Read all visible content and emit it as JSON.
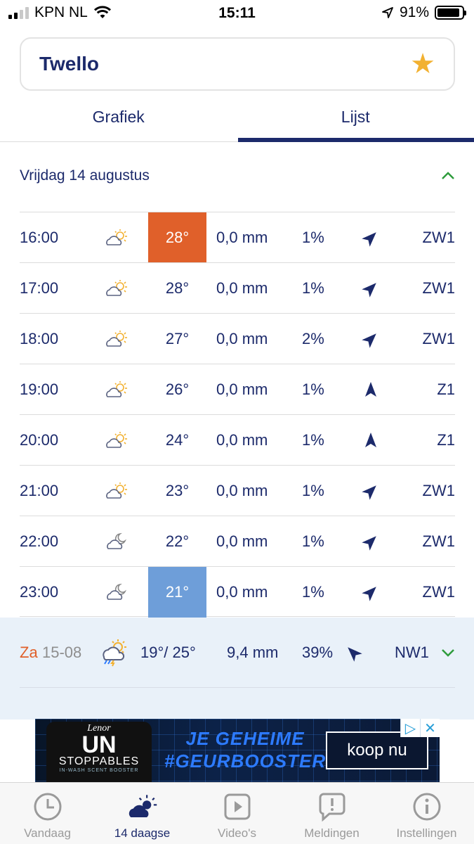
{
  "status_bar": {
    "carrier": "KPN NL",
    "time": "15:11",
    "battery": "91%"
  },
  "location": {
    "name": "Twello",
    "favorite_icon": "star-icon"
  },
  "tabs": [
    {
      "label": "Grafiek",
      "active": false
    },
    {
      "label": "Lijst",
      "active": true
    }
  ],
  "day": {
    "title": "Vrijdag 14 augustus"
  },
  "hours": [
    {
      "time": "16:00",
      "icon": "partly-cloudy-sun-icon",
      "temp": "28°",
      "highlight": "hot",
      "precip": "0,0 mm",
      "chance": "1%",
      "wind_dir": "ZW",
      "wind": "ZW1"
    },
    {
      "time": "17:00",
      "icon": "partly-cloudy-sun-icon",
      "temp": "28°",
      "highlight": "",
      "precip": "0,0 mm",
      "chance": "1%",
      "wind_dir": "ZW",
      "wind": "ZW1"
    },
    {
      "time": "18:00",
      "icon": "partly-cloudy-sun-icon",
      "temp": "27°",
      "highlight": "",
      "precip": "0,0 mm",
      "chance": "2%",
      "wind_dir": "ZW",
      "wind": "ZW1"
    },
    {
      "time": "19:00",
      "icon": "partly-cloudy-sun-icon",
      "temp": "26°",
      "highlight": "",
      "precip": "0,0 mm",
      "chance": "1%",
      "wind_dir": "Z",
      "wind": "Z1"
    },
    {
      "time": "20:00",
      "icon": "partly-cloudy-sun-icon",
      "temp": "24°",
      "highlight": "",
      "precip": "0,0 mm",
      "chance": "1%",
      "wind_dir": "Z",
      "wind": "Z1"
    },
    {
      "time": "21:00",
      "icon": "partly-cloudy-sun-icon",
      "temp": "23°",
      "highlight": "",
      "precip": "0,0 mm",
      "chance": "1%",
      "wind_dir": "ZW",
      "wind": "ZW1"
    },
    {
      "time": "22:00",
      "icon": "partly-cloudy-moon-icon",
      "temp": "22°",
      "highlight": "",
      "precip": "0,0 mm",
      "chance": "1%",
      "wind_dir": "ZW",
      "wind": "ZW1"
    },
    {
      "time": "23:00",
      "icon": "partly-cloudy-moon-icon",
      "temp": "21°",
      "highlight": "cold",
      "precip": "0,0 mm",
      "chance": "1%",
      "wind_dir": "ZW",
      "wind": "ZW1"
    }
  ],
  "next_day": {
    "day_name": "Za",
    "date": "15-08",
    "icon": "thunderstorm-sun-icon",
    "temp": "19°/ 25°",
    "precip": "9,4 mm",
    "chance": "39%",
    "wind_dir": "NW",
    "wind": "NW1"
  },
  "ad": {
    "brand": "Lenor",
    "product_line1": "UN",
    "product_line2": "STOPPABLES",
    "product_sub": "IN-WASH SCENT BOOSTER",
    "headline1": "JE GEHEIME",
    "headline2": "#GEURBOOSTER",
    "cta": "koop nu"
  },
  "bottom_nav": [
    {
      "label": "Vandaag",
      "icon": "clock-icon",
      "active": false
    },
    {
      "label": "14 daagse",
      "icon": "cloud-sun-icon",
      "active": true
    },
    {
      "label": "Video's",
      "icon": "play-icon",
      "active": false
    },
    {
      "label": "Meldingen",
      "icon": "alert-bubble-icon",
      "active": false
    },
    {
      "label": "Instellingen",
      "icon": "info-icon",
      "active": false
    }
  ],
  "colors": {
    "primary": "#1c2a6b",
    "hot": "#e0602a",
    "cold": "#6e9ed9",
    "accent_green": "#2e9c3c",
    "star": "#f2b131"
  }
}
